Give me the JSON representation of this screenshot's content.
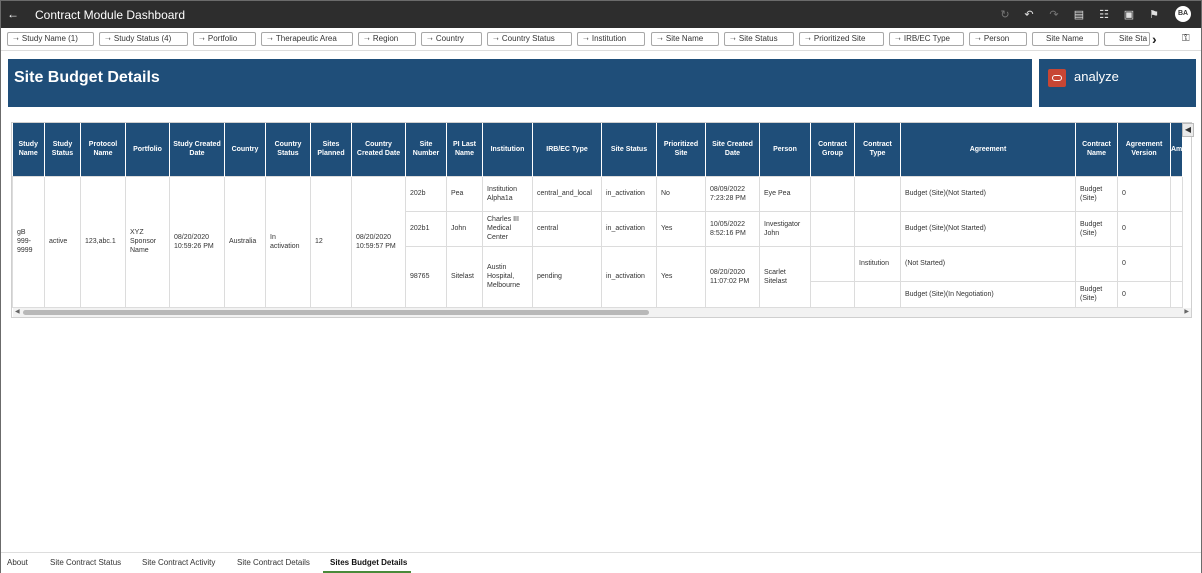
{
  "app": {
    "title": "Contract Module Dashboard",
    "user_initials": "BA"
  },
  "toolbar_icons": [
    "back-arrow-icon",
    "refresh-icon",
    "undo-icon",
    "redo-icon",
    "print-icon",
    "comment-icon",
    "export-icon",
    "bookmark-icon"
  ],
  "filters": [
    "Study Name (1)",
    "Study Status (4)",
    "Portfolio",
    "Therapeutic Area",
    "Region",
    "Country",
    "Country Status",
    "Institution",
    "Site Name",
    "Site Status",
    "Prioritized Site",
    "IRB/EC Type",
    "Person",
    "Site Name",
    "Site Sta"
  ],
  "header": {
    "title": "Site Budget Details"
  },
  "brand": {
    "label": "analyze",
    "logo_color": "#c74634"
  },
  "colors": {
    "band": "#1f4e79",
    "topbar": "#2d2d2d",
    "active_tab": "#4a8a3a"
  },
  "table": {
    "columns": [
      "Study Name",
      "Study Status",
      "Protocol Name",
      "Portfolio",
      "Study Created Date",
      "Country",
      "Country Status",
      "Sites Planned",
      "Country Created Date",
      "Site Number",
      "PI Last Name",
      "Institution",
      "IRB/EC Type",
      "Site Status",
      "Prioritized Site",
      "Site Created Date",
      "Person",
      "Contract Group",
      "Contract Type",
      "Agreement",
      "Contract Name",
      "Agreement Version",
      "Am"
    ],
    "group": {
      "study_name": "gB 999-9999",
      "study_status": "active",
      "protocol_name": "123,abc.1",
      "portfolio": "XYZ Sponsor Name",
      "study_created_date": "08/20/2020 10:59:26 PM",
      "country": "Australia",
      "country_status": "In activation",
      "sites_planned": "12",
      "country_created_date": "08/20/2020 10:59:57 PM"
    },
    "sites": [
      {
        "site_number": "202b",
        "pi_last_name": "Pea",
        "institution": "Institution Alpha1a",
        "irb": "central_and_local",
        "site_status": "in_activation",
        "prioritized": "No",
        "created": "08/09/2022 7:23:28 PM",
        "person": "Eye Pea",
        "contract_group": "",
        "contract_type": "",
        "agreement": "Budget (Site)(Not Started)",
        "contract_name": "Budget (Site)",
        "agreement_version": "0"
      },
      {
        "site_number": "202b1",
        "pi_last_name": "John",
        "institution": "Charles III Medical Center",
        "irb": "central",
        "site_status": "in_activation",
        "prioritized": "Yes",
        "created": "10/05/2022 8:52:16 PM",
        "person": "Investigator John",
        "contract_group": "",
        "contract_type": "",
        "agreement": "Budget (Site)(Not Started)",
        "contract_name": "Budget (Site)",
        "agreement_version": "0"
      },
      {
        "site_number": "98765",
        "pi_last_name": "Sitelast",
        "institution": "Austin Hospital, Melbourne",
        "irb": "pending",
        "site_status": "in_activation",
        "prioritized": "Yes",
        "created": "08/20/2020 11:07:02 PM",
        "person": "Scarlet Sitelast",
        "sub": [
          {
            "contract_group": "",
            "contract_type": "Institution",
            "agreement": "(Not Started)",
            "contract_name": "",
            "agreement_version": "0"
          },
          {
            "contract_group": "",
            "contract_type": "",
            "agreement": "Budget (Site)(In Negotiation)",
            "contract_name": "Budget (Site)",
            "agreement_version": "0"
          }
        ]
      }
    ]
  },
  "bottom_tabs": [
    "About",
    "Site Contract Status",
    "Site Contract Activity",
    "Site Contract Details",
    "Sites Budget Details"
  ],
  "active_tab": "Sites Budget Details"
}
